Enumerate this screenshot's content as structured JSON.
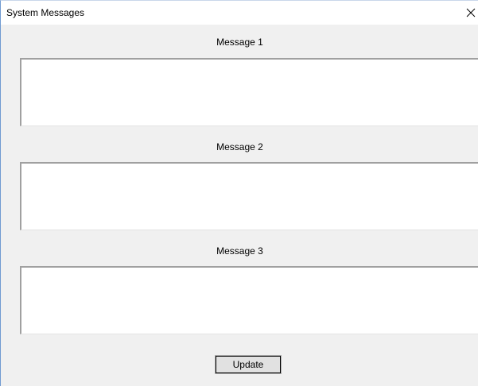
{
  "window": {
    "title": "System Messages"
  },
  "messages": [
    {
      "label": "Message 1",
      "value": ""
    },
    {
      "label": "Message 2",
      "value": ""
    },
    {
      "label": "Message 3",
      "value": ""
    }
  ],
  "actions": {
    "update_label": "Update"
  },
  "icons": {
    "close": "close-icon"
  }
}
